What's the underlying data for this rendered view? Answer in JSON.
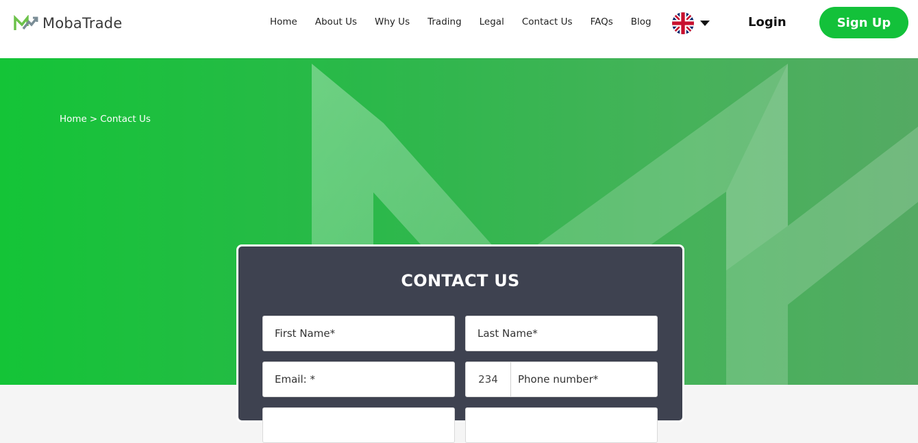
{
  "brand": {
    "name": "MobaTrade",
    "accent": "#13c13a"
  },
  "nav": {
    "items": [
      {
        "label": "Home"
      },
      {
        "label": "About Us"
      },
      {
        "label": "Why Us"
      },
      {
        "label": "Trading"
      },
      {
        "label": "Legal"
      },
      {
        "label": "Contact Us"
      },
      {
        "label": "FAQs"
      },
      {
        "label": "Blog"
      }
    ],
    "language_icon": "uk-flag-icon",
    "login_label": "Login",
    "signup_label": "Sign Up"
  },
  "breadcrumb": {
    "home": "Home",
    "separator": ">",
    "current": "Contact Us"
  },
  "contact_form": {
    "title": "CONTACT US",
    "first_name_placeholder": "First Name*",
    "last_name_placeholder": "Last Name*",
    "email_placeholder": "Email: *",
    "phone_code": "234",
    "phone_placeholder": "Phone number*"
  }
}
